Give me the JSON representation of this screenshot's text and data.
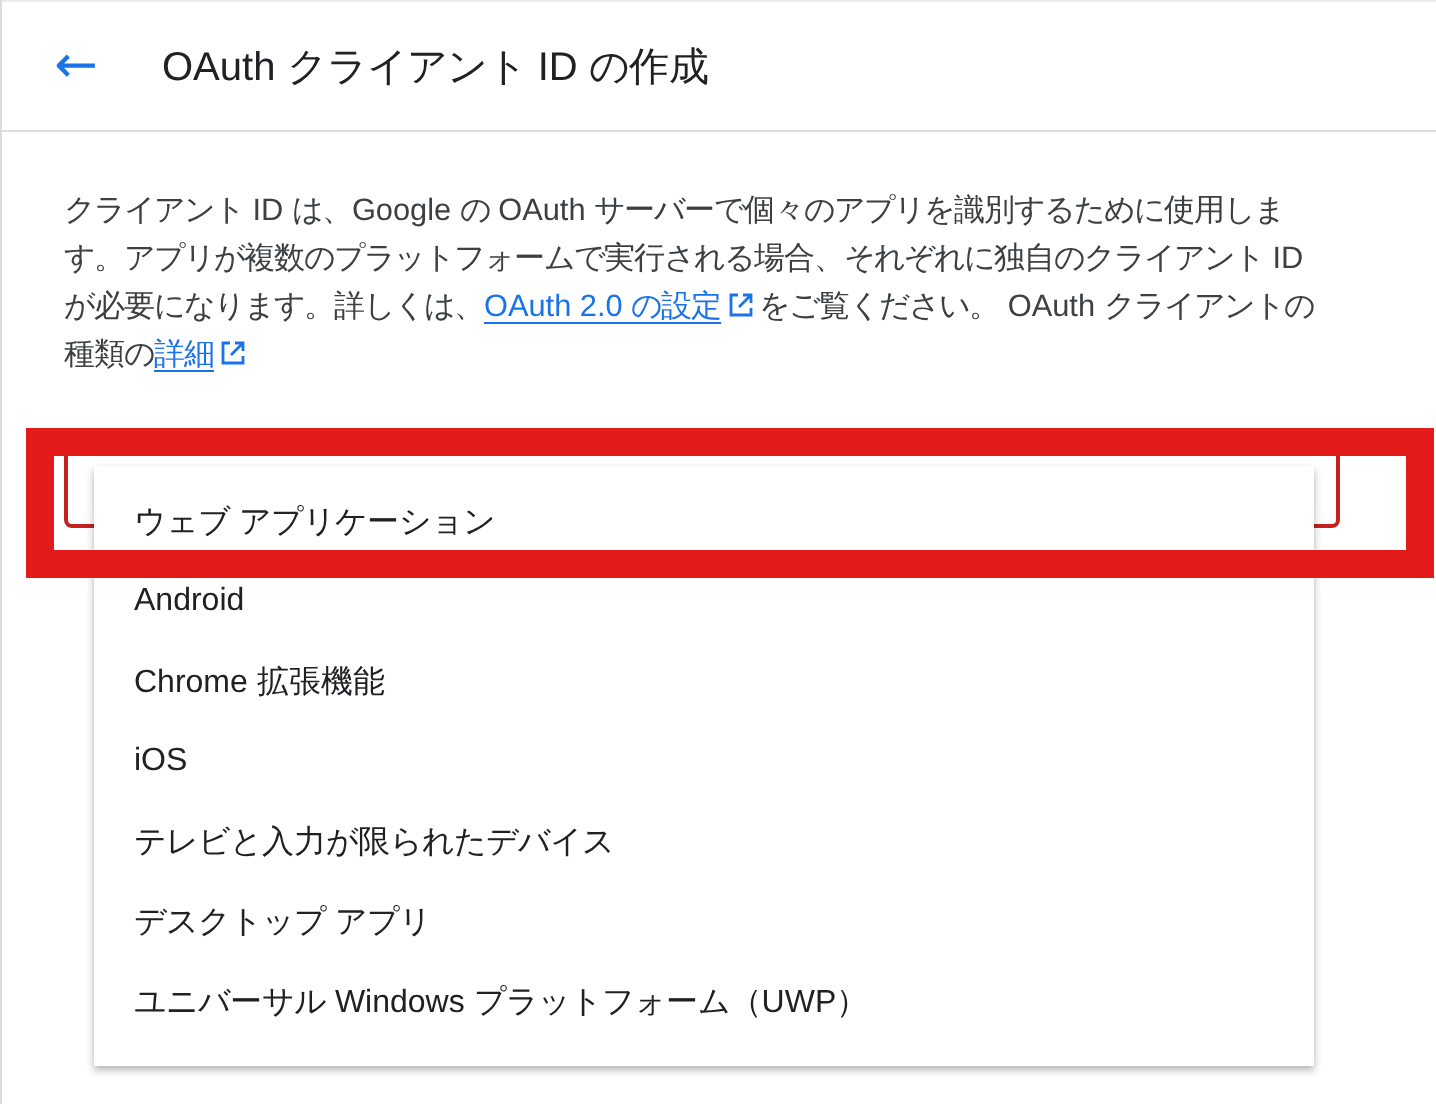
{
  "header": {
    "back_icon": "←",
    "title": "OAuth クライアント ID の作成"
  },
  "description": [
    {
      "kind": "text",
      "text": "クライアント ID は、Google の OAuth サーバーで個々のアプリを識別するために使用します。アプリが複数のプラットフォームで実行される場合、それぞれに独自のクライアント ID が必要になります。詳しくは、"
    },
    {
      "kind": "link",
      "text": "OAuth 2.0 の設定"
    },
    {
      "kind": "text",
      "text": "をご覧ください。 OAuth クライアントの種類の"
    },
    {
      "kind": "link",
      "text": "詳細"
    }
  ],
  "application_type_field": {
    "invalid": true,
    "highlighted": true
  },
  "menu": {
    "items": [
      "ウェブ アプリケーション",
      "Android",
      "Chrome 拡張機能",
      "iOS",
      "テレビと入力が限られたデバイス",
      "デスクトップ アプリ",
      "ユニバーサル Windows プラットフォーム（UWP）"
    ]
  }
}
